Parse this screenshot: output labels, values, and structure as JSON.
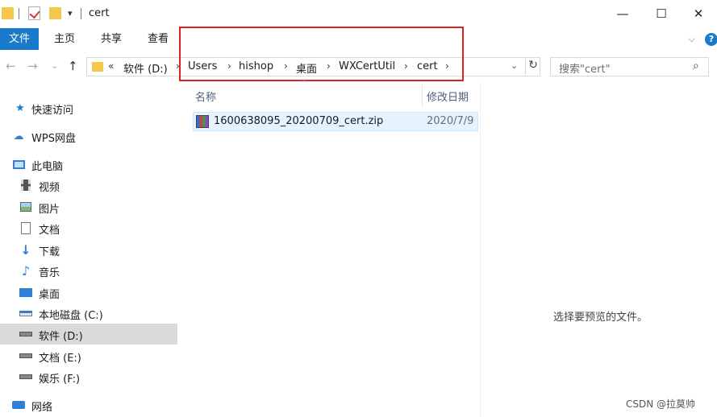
{
  "window": {
    "title": "cert",
    "quick_access_dropdown": "▾",
    "minimize": "—",
    "maximize": "☐",
    "close": "✕"
  },
  "ribbon": {
    "tabs": [
      "文件",
      "主页",
      "共享",
      "查看"
    ],
    "expand_chevron": "⌵",
    "help": "?"
  },
  "navigation": {
    "back": "←",
    "forward": "→",
    "recent": "⌄",
    "up": "↑"
  },
  "address": {
    "overflow": "«",
    "crumbs": [
      "软件 (D:)",
      "Users",
      "hishop",
      "桌面",
      "WXCertUtil",
      "cert"
    ],
    "separator": "›",
    "dropdown": "⌄",
    "refresh": "↻"
  },
  "search": {
    "placeholder": "搜索\"cert\"",
    "icon": "⌕"
  },
  "sidebar": {
    "items": [
      {
        "label": "快速访问",
        "icon": "star-icon"
      },
      {
        "label": "WPS网盘",
        "icon": "cloud-icon"
      },
      {
        "label": "此电脑",
        "icon": "computer-icon"
      },
      {
        "label": "视频",
        "icon": "video-icon"
      },
      {
        "label": "图片",
        "icon": "picture-icon"
      },
      {
        "label": "文档",
        "icon": "document-icon"
      },
      {
        "label": "下载",
        "icon": "download-icon"
      },
      {
        "label": "音乐",
        "icon": "music-icon"
      },
      {
        "label": "桌面",
        "icon": "desktop-icon"
      },
      {
        "label": "本地磁盘 (C:)",
        "icon": "drive-icon"
      },
      {
        "label": "软件 (D:)",
        "icon": "drive-icon",
        "selected": true
      },
      {
        "label": "文档 (E:)",
        "icon": "drive-icon"
      },
      {
        "label": "娱乐 (F:)",
        "icon": "drive-icon"
      },
      {
        "label": "网络",
        "icon": "network-icon"
      }
    ]
  },
  "file_list": {
    "columns": [
      "名称",
      "修改日期"
    ],
    "sort_indicator": "^",
    "files": [
      {
        "name": "1600638095_20200709_cert.zip",
        "modified": "2020/7/9",
        "icon": "zip-icon"
      }
    ]
  },
  "preview_pane": {
    "message": "选择要预览的文件。"
  },
  "watermark": "CSDN @拉莫帅",
  "colors": {
    "file_tab": "#1979ca",
    "selected_row": "#e5f3ff",
    "highlight_box": "#e02020"
  }
}
